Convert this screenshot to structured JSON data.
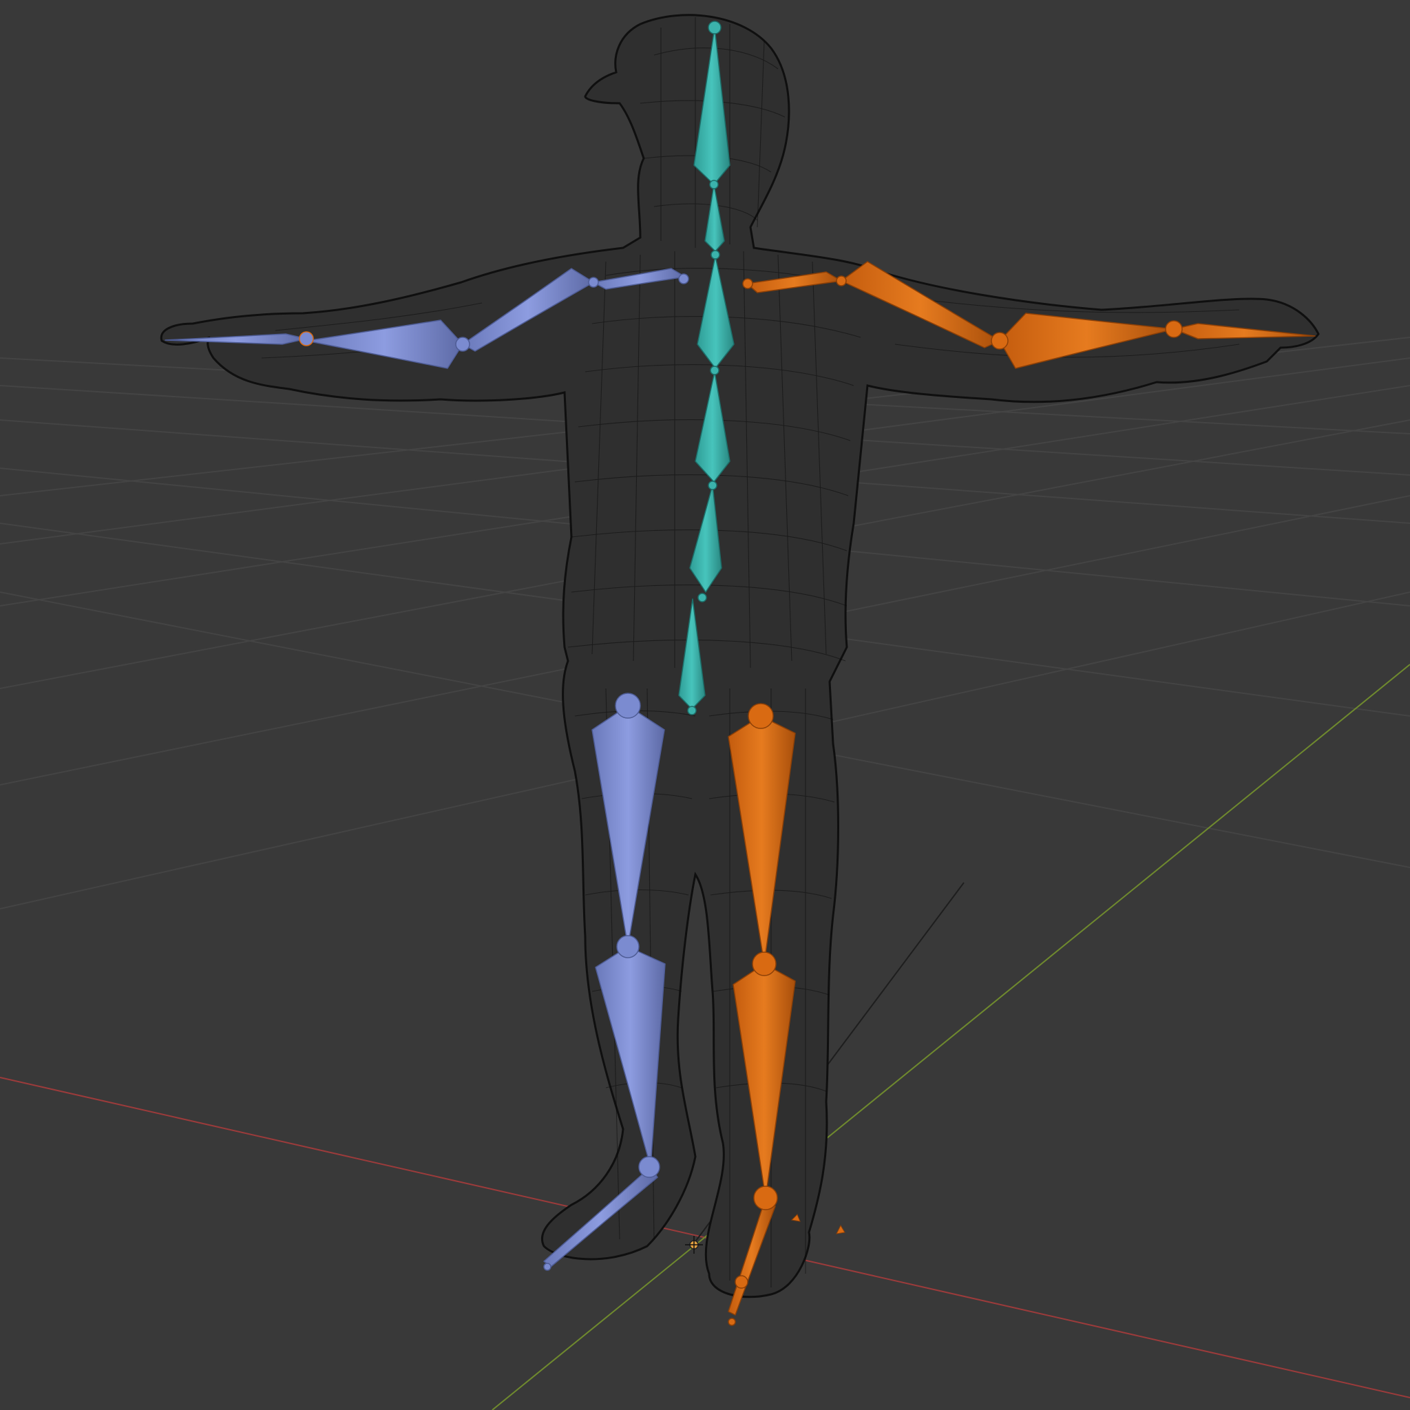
{
  "viewport": {
    "mode": "3D Viewport",
    "shading": "wireframe",
    "object": "character-mesh",
    "armature": "rig-armature"
  },
  "colors": {
    "background": "#393939",
    "grid": "#4a4a4a",
    "x_axis": "#9c3b3b",
    "y_axis": "#6f8a2e",
    "z_axis": "#2a2a2a",
    "mesh_wire": "#0b0b0b",
    "mesh_fill": "#2b2b2b",
    "bone_left": "#7b8bd0",
    "bone_left_edge": "#4f5d96",
    "bone_right": "#d96a12",
    "bone_right_edge": "#8d4007",
    "bone_spine": "#3bb3ac",
    "bone_spine_edge": "#1d6f6a",
    "origin": "#e0a040"
  },
  "icons": {
    "origin_marker": "origin-icon",
    "light_cursor": "cursor-icon"
  }
}
